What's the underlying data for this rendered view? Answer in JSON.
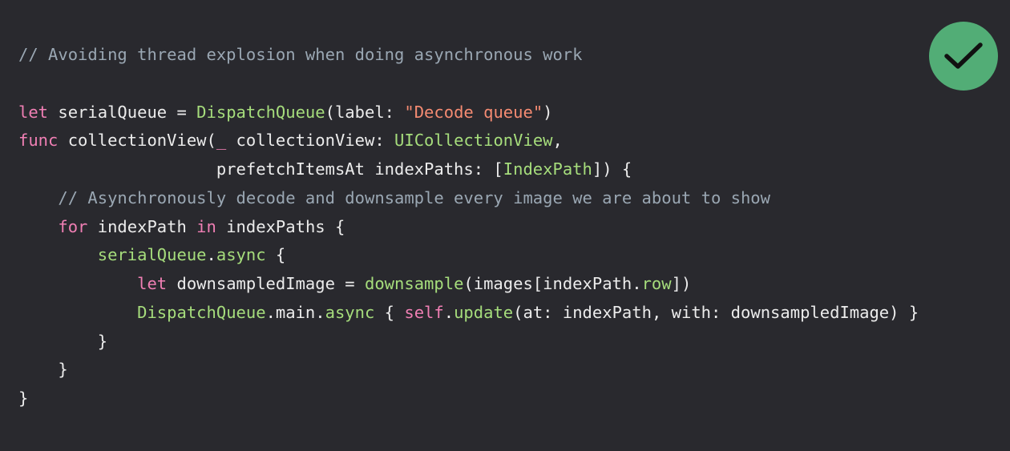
{
  "colors": {
    "background": "#29292e",
    "plain": "#ececec",
    "comment": "#9aa7b3",
    "keyword": "#f07fb4",
    "type": "#a6dd7c",
    "string": "#f58b72",
    "badge": "#52ad76",
    "badge_check": "#111111"
  },
  "badge": {
    "icon": "checkmark-icon"
  },
  "code": {
    "lines": [
      [
        {
          "t": "// Avoiding thread explosion when doing asynchronous work",
          "k": "comment"
        }
      ],
      [],
      [
        {
          "t": "let",
          "k": "keyword"
        },
        {
          "t": " serialQueue = ",
          "k": "plain"
        },
        {
          "t": "DispatchQueue",
          "k": "type"
        },
        {
          "t": "(label: ",
          "k": "plain"
        },
        {
          "t": "\"Decode queue\"",
          "k": "string"
        },
        {
          "t": ")",
          "k": "plain"
        }
      ],
      [
        {
          "t": "func",
          "k": "keyword"
        },
        {
          "t": " collectionView(",
          "k": "plain"
        },
        {
          "t": "_",
          "k": "keyword"
        },
        {
          "t": " collectionView: ",
          "k": "plain"
        },
        {
          "t": "UICollectionView",
          "k": "type"
        },
        {
          "t": ",",
          "k": "plain"
        }
      ],
      [
        {
          "t": "                    prefetchItemsAt indexPaths: [",
          "k": "plain"
        },
        {
          "t": "IndexPath",
          "k": "type"
        },
        {
          "t": "]) {",
          "k": "plain"
        }
      ],
      [
        {
          "t": "    // Asynchronously decode and downsample every image we are about to show",
          "k": "comment"
        }
      ],
      [
        {
          "t": "    ",
          "k": "plain"
        },
        {
          "t": "for",
          "k": "keyword"
        },
        {
          "t": " indexPath ",
          "k": "plain"
        },
        {
          "t": "in",
          "k": "keyword"
        },
        {
          "t": " indexPaths {",
          "k": "plain"
        }
      ],
      [
        {
          "t": "        ",
          "k": "plain"
        },
        {
          "t": "serialQueue",
          "k": "type"
        },
        {
          "t": ".",
          "k": "plain"
        },
        {
          "t": "async",
          "k": "type"
        },
        {
          "t": " {",
          "k": "plain"
        }
      ],
      [
        {
          "t": "            ",
          "k": "plain"
        },
        {
          "t": "let",
          "k": "keyword"
        },
        {
          "t": " downsampledImage = ",
          "k": "plain"
        },
        {
          "t": "downsample",
          "k": "type"
        },
        {
          "t": "(images[indexPath.",
          "k": "plain"
        },
        {
          "t": "row",
          "k": "type"
        },
        {
          "t": "])",
          "k": "plain"
        }
      ],
      [
        {
          "t": "            ",
          "k": "plain"
        },
        {
          "t": "DispatchQueue",
          "k": "type"
        },
        {
          "t": ".main.",
          "k": "plain"
        },
        {
          "t": "async",
          "k": "type"
        },
        {
          "t": " { ",
          "k": "plain"
        },
        {
          "t": "self",
          "k": "keyword"
        },
        {
          "t": ".",
          "k": "plain"
        },
        {
          "t": "update",
          "k": "type"
        },
        {
          "t": "(at: indexPath, with: downsampledImage) }",
          "k": "plain"
        }
      ],
      [
        {
          "t": "        }",
          "k": "plain"
        }
      ],
      [
        {
          "t": "    }",
          "k": "plain"
        }
      ],
      [
        {
          "t": "}",
          "k": "plain"
        }
      ]
    ]
  }
}
